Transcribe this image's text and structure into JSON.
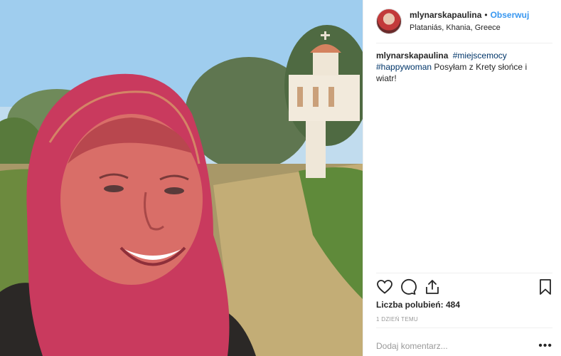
{
  "post": {
    "username": "mlynarskapaulina",
    "separator": "•",
    "follow_label": "Obserwuj",
    "location": "Plataniás, Khania, Greece"
  },
  "caption": {
    "username": "mlynarskapaulina",
    "hashtag1": "#miejscemocy",
    "hashtag2": "#happywoman",
    "text": " Posyłam z Krety słońce i wiatr!"
  },
  "actions": {
    "icons": [
      "heart-icon",
      "comment-icon",
      "share-icon",
      "bookmark-icon"
    ]
  },
  "likes": {
    "label": "Liczba polubień: 484"
  },
  "time": {
    "label": "1 dzień temu"
  },
  "comment": {
    "placeholder": "Dodaj komentarz...",
    "more_label": "•••"
  },
  "colors": {
    "link_blue": "#3897f0",
    "hashtag_blue": "#003569",
    "text": "#262626",
    "muted": "#999999",
    "border": "#efefef"
  }
}
